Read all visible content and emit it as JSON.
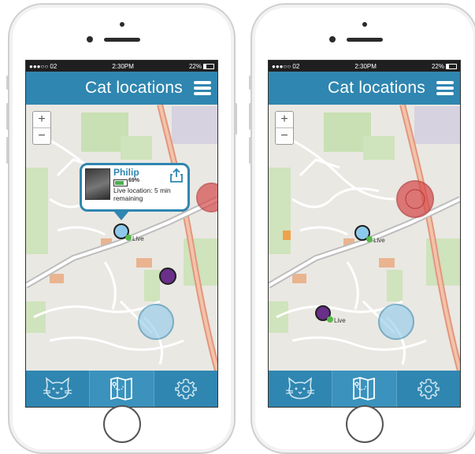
{
  "status": {
    "carrier": "●●●○○ 02",
    "time": "2:30PM",
    "battery": "22%"
  },
  "app": {
    "title": "Cat locations"
  },
  "map": {
    "zoom_in": "+",
    "zoom_out": "−"
  },
  "popup": {
    "name": "Philip",
    "battery": "69%",
    "location_text": "Live location: 5 min remaining"
  },
  "markers": {
    "live_label": "Live"
  },
  "tabs": [
    {
      "icon": "cat-face-icon"
    },
    {
      "icon": "map-icon"
    },
    {
      "icon": "gear-icon"
    }
  ],
  "colors": {
    "primary": "#2f86b0",
    "live_dot": "#58b84a",
    "marker_blue": "#8ec9eb",
    "marker_purple": "#6a2f8a",
    "zone_red": "#d64b4b"
  }
}
